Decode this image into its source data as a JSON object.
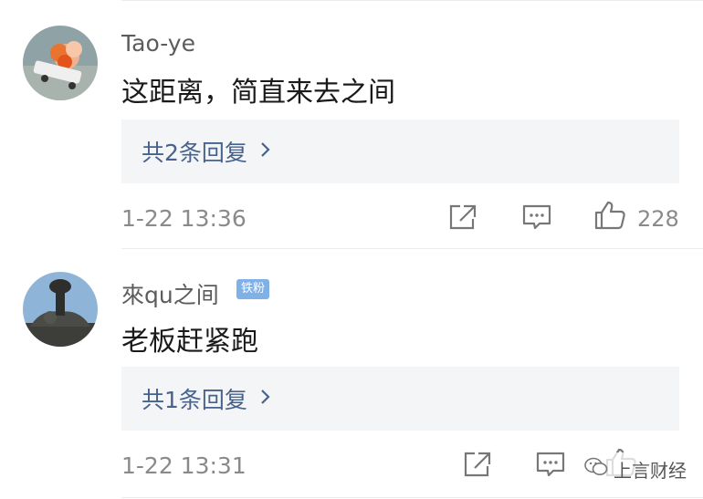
{
  "comments": [
    {
      "username": "Tao-ye",
      "badge": "",
      "content": "这距离，简直来去之间",
      "replies_label": "共2条回复",
      "time": "1-22 13:36",
      "likes": "228"
    },
    {
      "username": "來qu之间",
      "badge": "铁粉",
      "content": "老板赶紧跑",
      "replies_label": "共1条回复",
      "time": "1-22 13:31",
      "likes": ""
    }
  ],
  "watermark": "上言财经",
  "icons": {
    "share": "share-icon",
    "comment": "comment-icon",
    "like": "thumbs-up-icon",
    "chevron": "chevron-right-icon"
  },
  "colors": {
    "reply_link": "#47628c",
    "badge_bg": "#7fb0e6",
    "reply_bg": "#f4f5f7"
  }
}
